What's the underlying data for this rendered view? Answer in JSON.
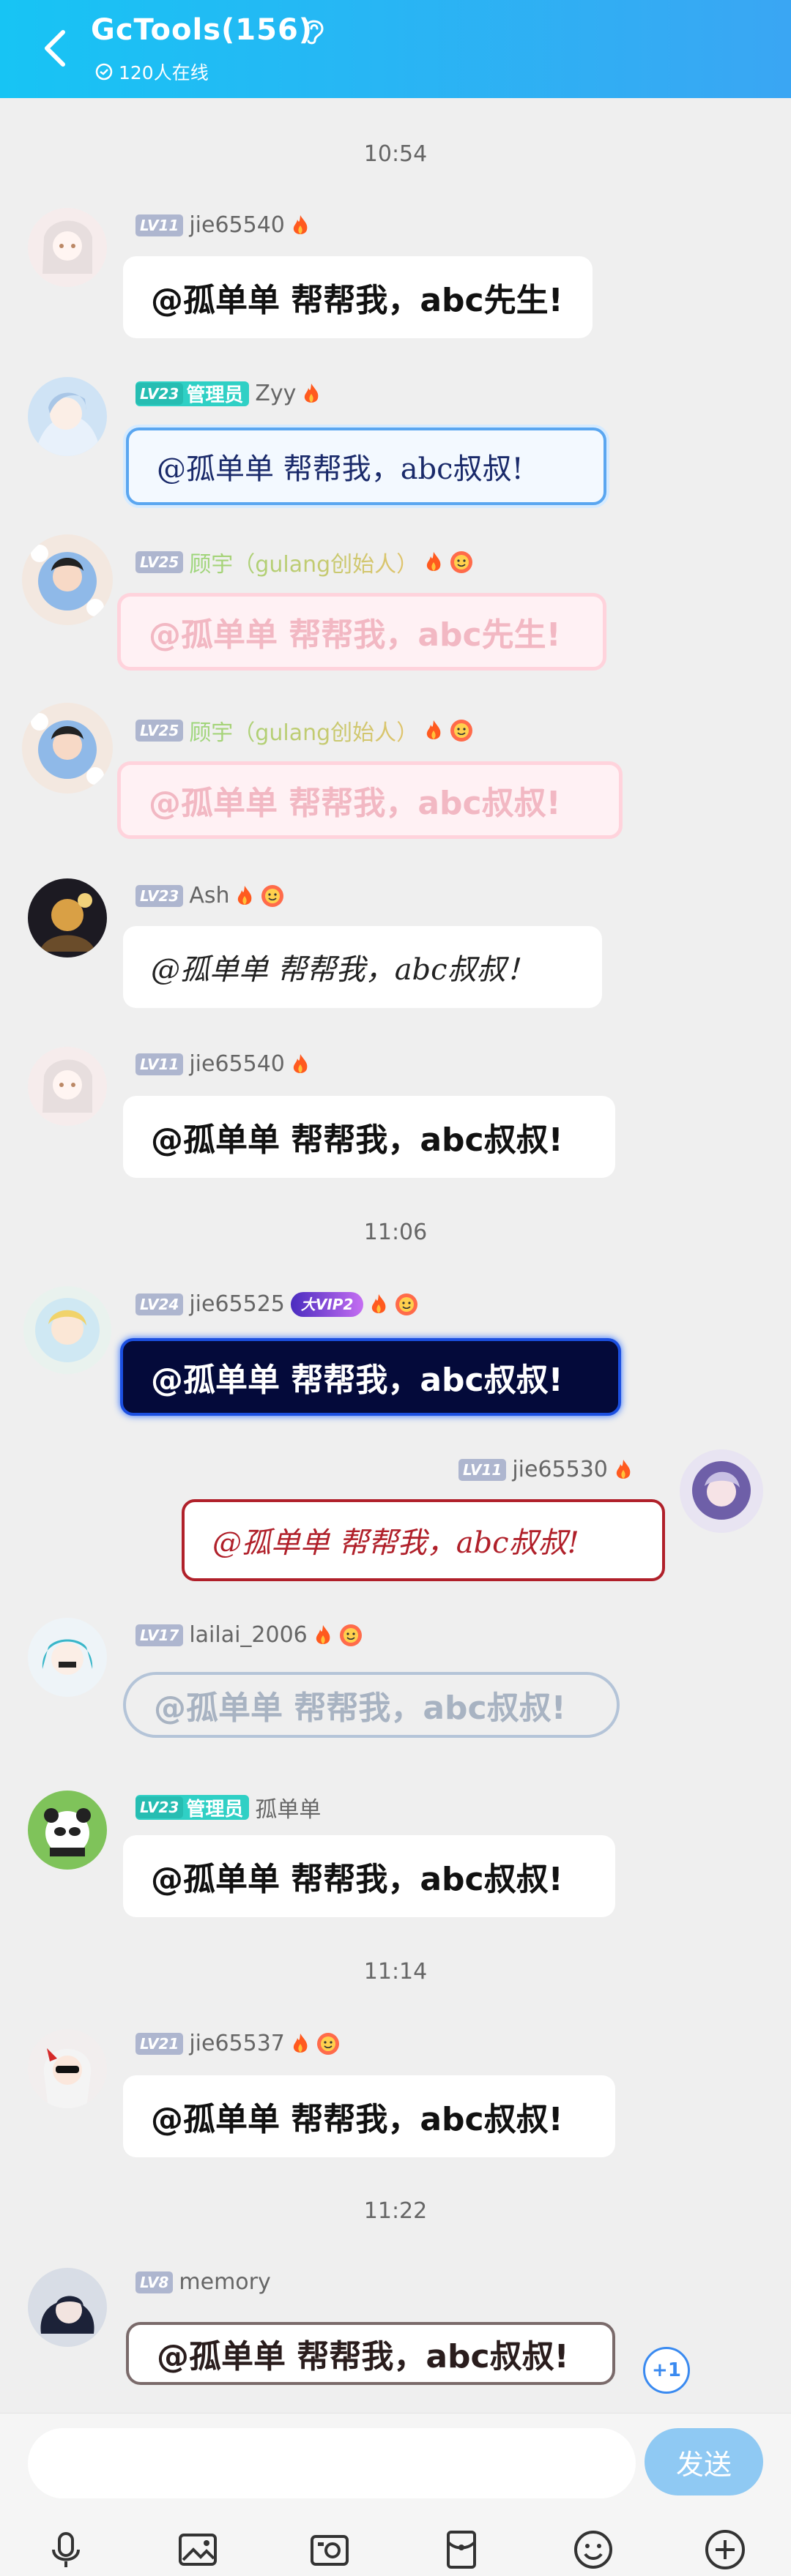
{
  "header": {
    "title": "GcTools(156)",
    "online": "120人在线"
  },
  "timestamps": [
    "10:54",
    "11:06",
    "11:14",
    "11:22"
  ],
  "messages": [
    {
      "level": "LV11",
      "user": "jie65540",
      "text": "@孤单单 帮帮我，abc先生!"
    },
    {
      "level": "LV23",
      "role": "管理员",
      "user": "Zyy",
      "text": "@孤单单 帮帮我，abc叔叔!"
    },
    {
      "level": "LV25",
      "user": "顾宇（gulang创始人）",
      "text": "@孤单单 帮帮我，abc先生!"
    },
    {
      "level": "LV25",
      "user": "顾宇（gulang创始人）",
      "text": "@孤单单 帮帮我，abc叔叔!"
    },
    {
      "level": "LV23",
      "user": "Ash",
      "text": "@孤单单 帮帮我，abc叔叔！"
    },
    {
      "level": "LV11",
      "user": "jie65540",
      "text": "@孤单单 帮帮我，abc叔叔!"
    },
    {
      "level": "LV24",
      "user": "jie65525",
      "vip": "大VIP2",
      "text": "@孤单单 帮帮我，abc叔叔!"
    },
    {
      "level": "LV11",
      "user": "jie65530",
      "text": "@孤单单 帮帮我，abc叔叔!"
    },
    {
      "level": "LV17",
      "user": "lailai_2006",
      "text": "@孤单单 帮帮我，abc叔叔!"
    },
    {
      "level": "LV23",
      "role": "管理员",
      "user": "孤单单",
      "text": "@孤单单 帮帮我，abc叔叔!"
    },
    {
      "level": "LV21",
      "user": "jie65537",
      "text": "@孤单单 帮帮我，abc叔叔!"
    },
    {
      "level": "LV8",
      "user": "memory",
      "text": "@孤单单 帮帮我，abc叔叔!"
    }
  ],
  "plus_one": "+1",
  "input": {
    "placeholder": "",
    "send_label": "发送"
  },
  "colors": {
    "header_start": "#17c4f4",
    "header_end": "#3aa6f3",
    "send": "#8fc9f3",
    "admin": "#2fd0c5",
    "level_badge": "#aeb6cf"
  }
}
